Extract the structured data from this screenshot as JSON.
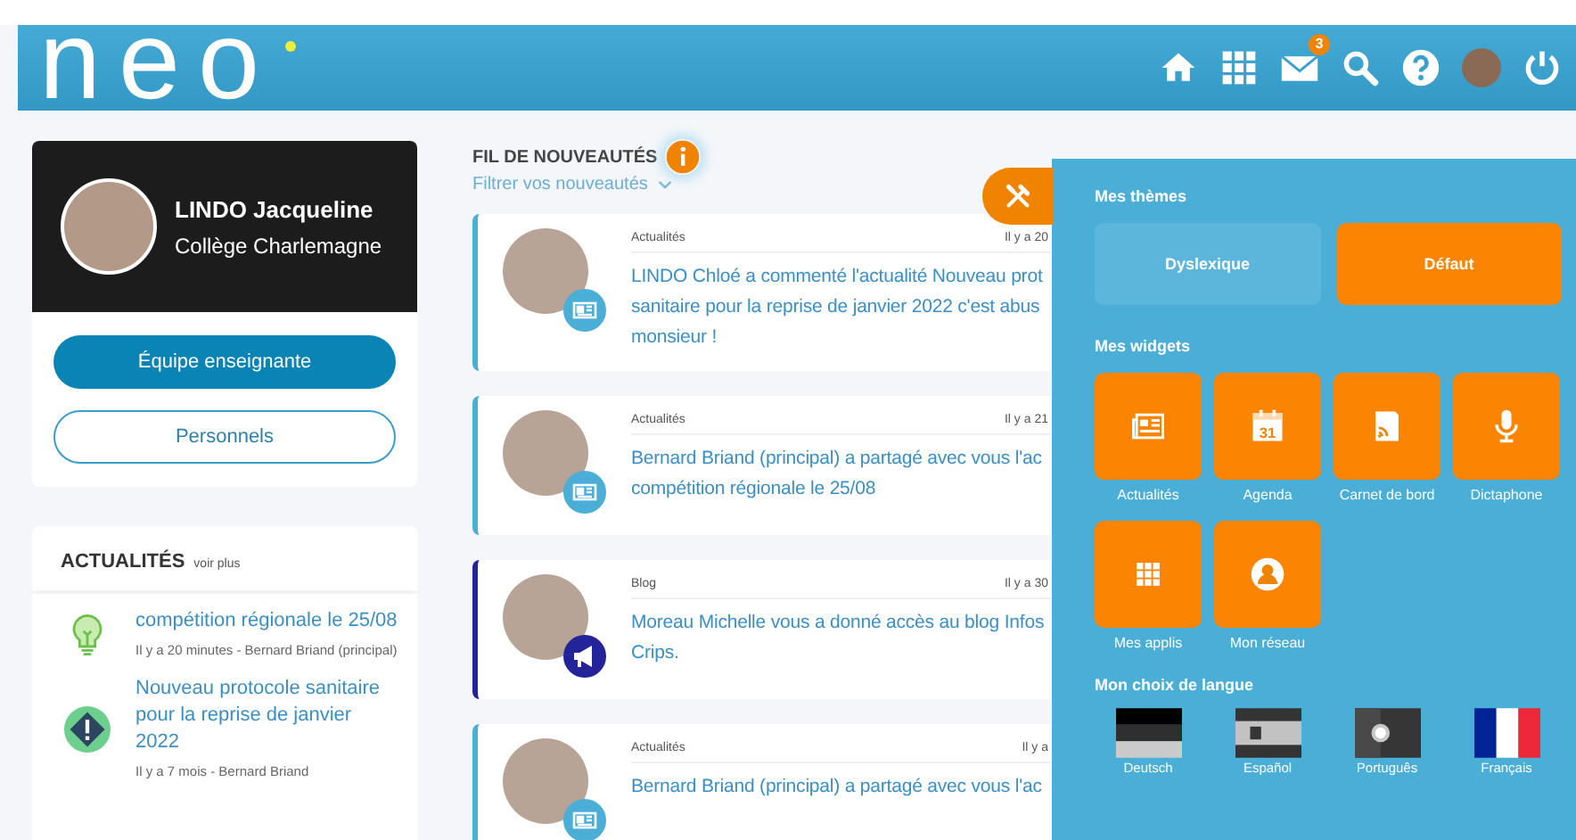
{
  "header": {
    "logo": "neo",
    "mail_badge": "3"
  },
  "profile": {
    "name": "LINDO Jacqueline",
    "school": "Collège Charlemagne",
    "buttons": [
      {
        "label": "Équipe enseignante",
        "kind": "primary"
      },
      {
        "label": "Personnels",
        "kind": "outline"
      }
    ]
  },
  "news_widget": {
    "title": "ACTUALITÉS",
    "more": "voir plus",
    "items": [
      {
        "kind": "idea",
        "title": "compétition régionale le 25/08",
        "meta": "Il y a 20 minutes - Bernard Briand (principal)"
      },
      {
        "kind": "alert",
        "title": "Nouveau protocole sanitaire pour la reprise de janvier 2022",
        "meta": "Il y a 7 mois - Bernard Briand"
      }
    ]
  },
  "feed": {
    "title": "FIL DE NOUVEAUTÉS",
    "filter": "Filtrer vos nouveautés",
    "items": [
      {
        "kind": "news",
        "category": "Actualités",
        "time": "Il y a 20",
        "lines": [
          "LINDO Chloé a commenté l'actualité Nouveau prot",
          "sanitaire pour la reprise de janvier 2022 c'est abus",
          "monsieur !"
        ]
      },
      {
        "kind": "news",
        "category": "Actualités",
        "time": "Il y a 21",
        "lines": [
          "Bernard Briand (principal) a partagé avec vous l'ac",
          "compétition régionale le 25/08"
        ]
      },
      {
        "kind": "blog",
        "category": "Blog",
        "time": "Il y a 30",
        "lines": [
          "Moreau Michelle vous a donné accès au blog Infos",
          "Crips."
        ]
      },
      {
        "kind": "news",
        "category": "Actualités",
        "time": "Il y a",
        "lines": [
          "Bernard Briand (principal) a partagé avec vous l'ac"
        ]
      }
    ]
  },
  "panel": {
    "themes_title": "Mes thèmes",
    "themes": [
      {
        "label": "Dyslexique",
        "selected": false
      },
      {
        "label": "Défaut",
        "selected": true
      }
    ],
    "widgets_title": "Mes widgets",
    "widgets": [
      {
        "kind": "news",
        "label": "Actualités"
      },
      {
        "kind": "calendar",
        "label": "Agenda",
        "icon_text": "31"
      },
      {
        "kind": "notebook",
        "label": "Carnet de bord"
      },
      {
        "kind": "mic",
        "label": "Dictaphone"
      },
      {
        "kind": "apps",
        "label": "Mes applis"
      },
      {
        "kind": "network",
        "label": "Mon réseau"
      }
    ],
    "language_title": "Mon choix de langue",
    "languages": [
      {
        "kind": "de",
        "label": "Deutsch",
        "selected": false
      },
      {
        "kind": "es",
        "label": "Español",
        "selected": false
      },
      {
        "kind": "pt",
        "label": "Português",
        "selected": false
      },
      {
        "kind": "fr",
        "label": "Français",
        "selected": true
      }
    ]
  }
}
